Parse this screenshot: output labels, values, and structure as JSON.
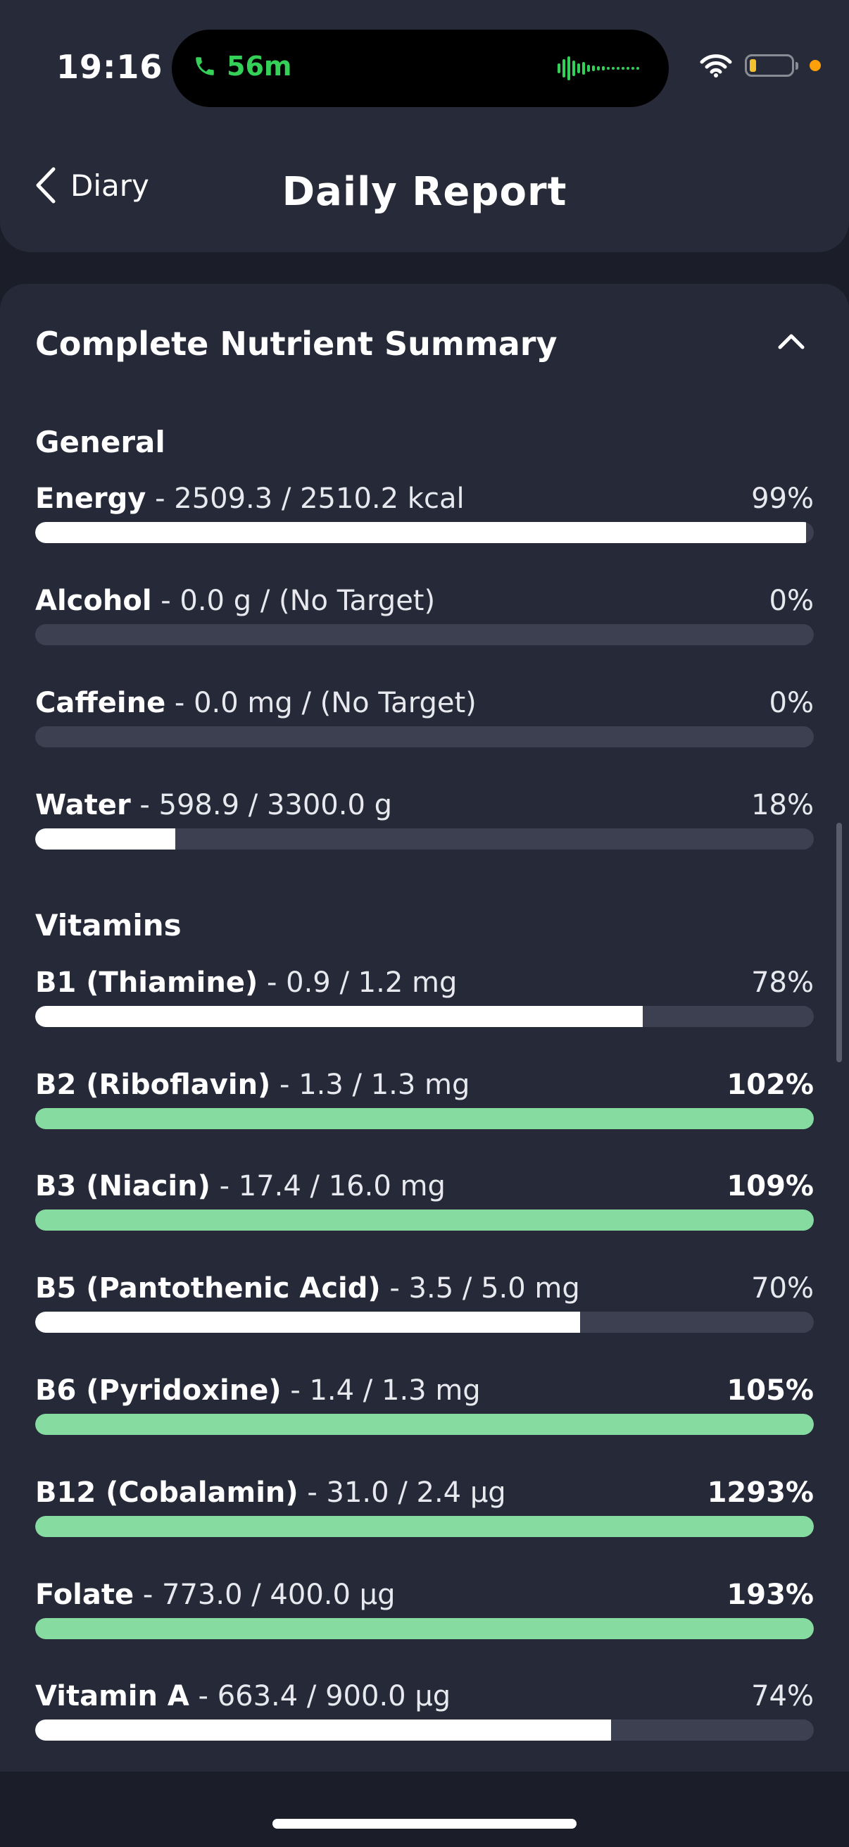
{
  "status_bar": {
    "time": "19:16",
    "call_duration": "56m",
    "icons": [
      "phone-icon",
      "audio-wave-icon",
      "wifi-icon",
      "battery-icon",
      "recording-dot-icon"
    ],
    "colors": {
      "call": "#34d058",
      "battery": "#f2c230",
      "dot": "#ff9f0a"
    }
  },
  "header": {
    "back_label": "Diary",
    "title": "Daily Report"
  },
  "card": {
    "title": "Complete Nutrient Summary",
    "collapse_icon": "chevron-up-icon"
  },
  "colors": {
    "met_target": "#86dba0",
    "progress": "#ffffff",
    "track": "#3d4050",
    "background": "#1b1d29",
    "card": "#262938"
  },
  "sections": [
    {
      "label": "General",
      "rows": [
        {
          "name": "Energy",
          "detail": " - 2509.3 / 2510.2 kcal",
          "pct": "99%",
          "progress": 0.99,
          "met": false
        },
        {
          "name": "Alcohol",
          "detail": " - 0.0 g / (No Target)",
          "pct": "0%",
          "progress": 0,
          "met": false
        },
        {
          "name": "Caffeine",
          "detail": " - 0.0 mg / (No Target)",
          "pct": "0%",
          "progress": 0,
          "met": false
        },
        {
          "name": "Water",
          "detail": " - 598.9 / 3300.0 g",
          "pct": "18%",
          "progress": 0.18,
          "met": false
        }
      ]
    },
    {
      "label": "Vitamins",
      "rows": [
        {
          "name": "B1 (Thiamine)",
          "detail": " - 0.9 / 1.2 mg",
          "pct": "78%",
          "progress": 0.78,
          "met": false
        },
        {
          "name": "B2 (Riboflavin)",
          "detail": " - 1.3 / 1.3 mg",
          "pct": "102%",
          "progress": 1,
          "met": true
        },
        {
          "name": "B3 (Niacin)",
          "detail": " - 17.4 / 16.0 mg",
          "pct": "109%",
          "progress": 1,
          "met": true
        },
        {
          "name": "B5 (Pantothenic Acid)",
          "detail": " - 3.5 / 5.0 mg",
          "pct": "70%",
          "progress": 0.7,
          "met": false
        },
        {
          "name": "B6 (Pyridoxine)",
          "detail": " - 1.4 / 1.3 mg",
          "pct": "105%",
          "progress": 1,
          "met": true
        },
        {
          "name": "B12 (Cobalamin)",
          "detail": " - 31.0 / 2.4 µg",
          "pct": "1293%",
          "progress": 1,
          "met": true
        },
        {
          "name": "Folate",
          "detail": " - 773.0 / 400.0 µg",
          "pct": "193%",
          "progress": 1,
          "met": true
        },
        {
          "name": "Vitamin A",
          "detail": " - 663.4 / 900.0 µg",
          "pct": "74%",
          "progress": 0.74,
          "met": false
        }
      ]
    }
  ]
}
